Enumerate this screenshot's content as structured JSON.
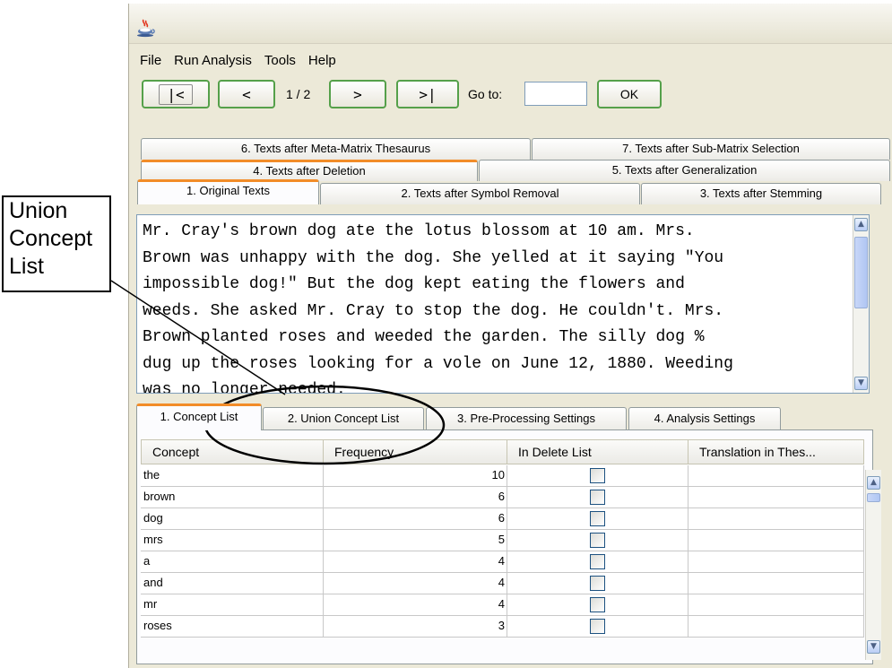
{
  "callout": {
    "text": "Union\nConcept\nList"
  },
  "menu": [
    "File",
    "Run Analysis",
    "Tools",
    "Help"
  ],
  "toolbar": {
    "first": "|<",
    "prev": "<",
    "page": "1 / 2",
    "next": ">",
    "last": ">|",
    "goto_label": "Go to:",
    "goto_value": "",
    "ok": "OK"
  },
  "text_tabs": [
    "1. Original Texts",
    "2. Texts after Symbol Removal",
    "3. Texts after Stemming",
    "4. Texts after Deletion",
    "5. Texts after Generalization",
    "6. Texts after Meta-Matrix Thesaurus",
    "7. Texts after Sub-Matrix Selection"
  ],
  "text_body": "Mr. Cray's brown dog ate the lotus blossom at 10 am. Mrs.\nBrown was unhappy with the dog. She yelled at it saying \"You\nimpossible dog!\" But the dog kept eating the flowers and\nweeds. She asked Mr. Cray to stop the dog. He couldn't. Mrs.\nBrown planted roses and weeded the garden. The silly dog %\ndug up the roses looking for a vole on June 12, 1880. Weeding\nwas no longer needed.",
  "bottom_tabs": [
    "1. Concept List",
    "2. Union Concept List",
    "3. Pre-Processing Settings",
    "4. Analysis Settings"
  ],
  "table": {
    "columns": [
      "Concept",
      "Frequency",
      "In Delete List",
      "Translation in Thes..."
    ],
    "rows": [
      {
        "concept": "the",
        "frequency": "10",
        "delete": false,
        "translation": ""
      },
      {
        "concept": "brown",
        "frequency": "6",
        "delete": false,
        "translation": ""
      },
      {
        "concept": "dog",
        "frequency": "6",
        "delete": false,
        "translation": ""
      },
      {
        "concept": "mrs",
        "frequency": "5",
        "delete": false,
        "translation": ""
      },
      {
        "concept": "a",
        "frequency": "4",
        "delete": false,
        "translation": ""
      },
      {
        "concept": "and",
        "frequency": "4",
        "delete": false,
        "translation": ""
      },
      {
        "concept": "mr",
        "frequency": "4",
        "delete": false,
        "translation": ""
      },
      {
        "concept": "roses",
        "frequency": "3",
        "delete": false,
        "translation": ""
      }
    ]
  },
  "colors": {
    "accent_tab": "#f28c28",
    "button_border": "#55a04a",
    "window_bg": "#ece9d8"
  },
  "icons": {
    "app": "java-coffee-cup-icon"
  }
}
